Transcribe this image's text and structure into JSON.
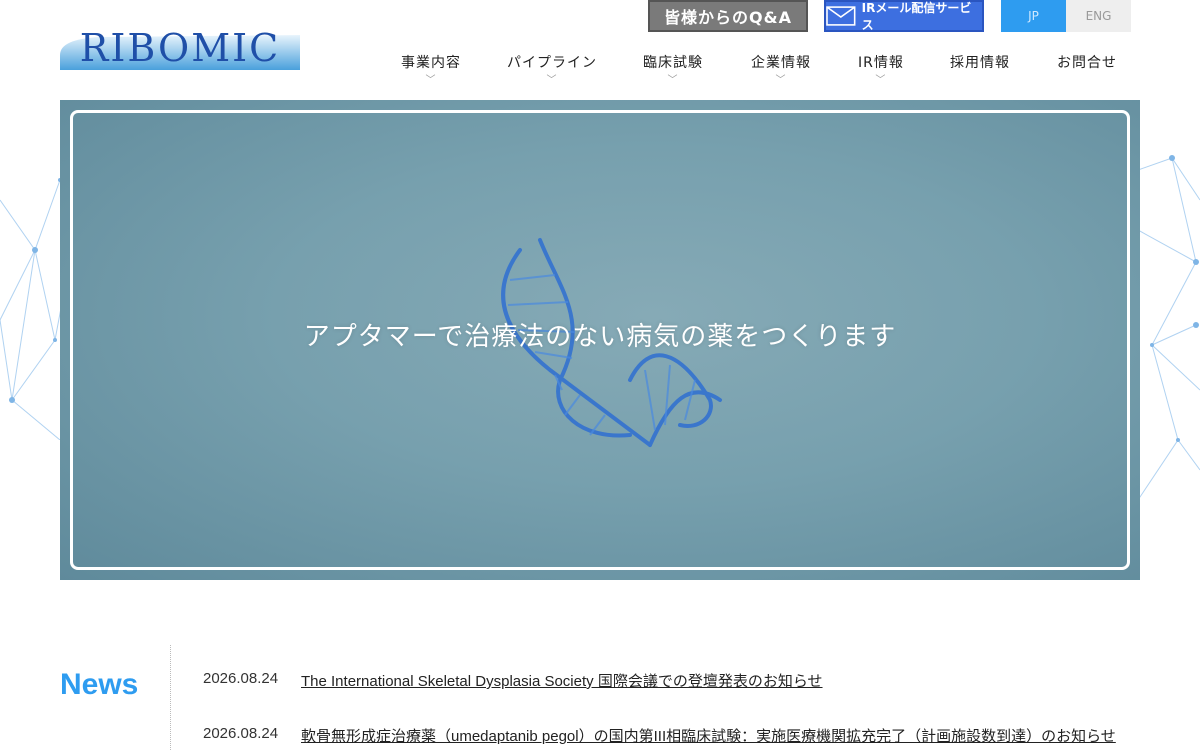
{
  "header": {
    "logo_text": "RIBOMIC",
    "qa_button": "皆様からのQ&A",
    "ir_button": "IRメール配信サービス",
    "lang": {
      "jp": "JP",
      "eng": "ENG"
    }
  },
  "nav": {
    "items": [
      {
        "label": "事業内容",
        "has_dropdown": true
      },
      {
        "label": "パイプライン",
        "has_dropdown": true
      },
      {
        "label": "臨床試験",
        "has_dropdown": true
      },
      {
        "label": "企業情報",
        "has_dropdown": true
      },
      {
        "label": "IR情報",
        "has_dropdown": true
      },
      {
        "label": "採用情報",
        "has_dropdown": false
      },
      {
        "label": "お問合せ",
        "has_dropdown": false
      }
    ],
    "chevron": "﹀"
  },
  "hero": {
    "tagline": "アプタマーで治療法のない病気の薬をつくります"
  },
  "news": {
    "title": "News",
    "items": [
      {
        "date": "2026.08.24",
        "text": "The International Skeletal Dysplasia Society 国際会議での登壇発表のお知らせ"
      },
      {
        "date": "2026.08.24",
        "text": "軟骨無形成症治療薬（umedaptanib pegol）の国内第III相臨床試験：実施医療機関拡充完了（計画施設数到達）のお知らせ"
      }
    ]
  },
  "colors": {
    "accent": "#2e9cf0",
    "hero_bg": "#77a0ae",
    "qa_bg": "#7a7a7a",
    "ir_bg": "#3d6fe0"
  }
}
